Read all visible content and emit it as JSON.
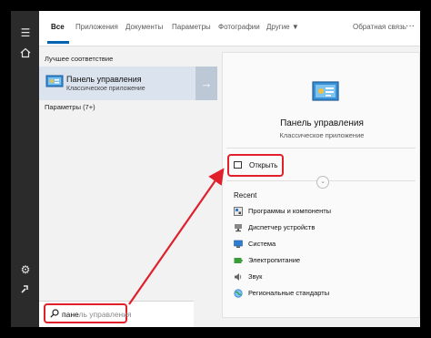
{
  "tabs": [
    {
      "label": "Все",
      "active": true
    },
    {
      "label": "Приложения"
    },
    {
      "label": "Документы"
    },
    {
      "label": "Параметры"
    },
    {
      "label": "Фотографии"
    },
    {
      "label": "Другие ▼"
    },
    {
      "label": "Обратная связь"
    }
  ],
  "left": {
    "best_match_header": "Лучшее соответствие",
    "best_match": {
      "title": "Панель управления",
      "subtitle": "Классическое приложение"
    },
    "settings_header": "Параметры (7+)"
  },
  "preview": {
    "title": "Панель управления",
    "subtitle": "Классическое приложение",
    "open_label": "Открыть",
    "recent_header": "Recent",
    "recent_items": [
      {
        "label": "Программы и компоненты",
        "icon": "programs-icon"
      },
      {
        "label": "Диспетчер устройств",
        "icon": "device-manager-icon"
      },
      {
        "label": "Система",
        "icon": "system-icon"
      },
      {
        "label": "Электропитание",
        "icon": "power-icon"
      },
      {
        "label": "Звук",
        "icon": "sound-icon"
      },
      {
        "label": "Региональные стандарты",
        "icon": "region-icon"
      }
    ]
  },
  "search": {
    "typed": "пане",
    "suggestion": "ль управления"
  },
  "colors": {
    "accent": "#0063b1",
    "highlight": "#e0202a",
    "rail": "#2b2b2b",
    "selected": "#dbe4ee"
  }
}
